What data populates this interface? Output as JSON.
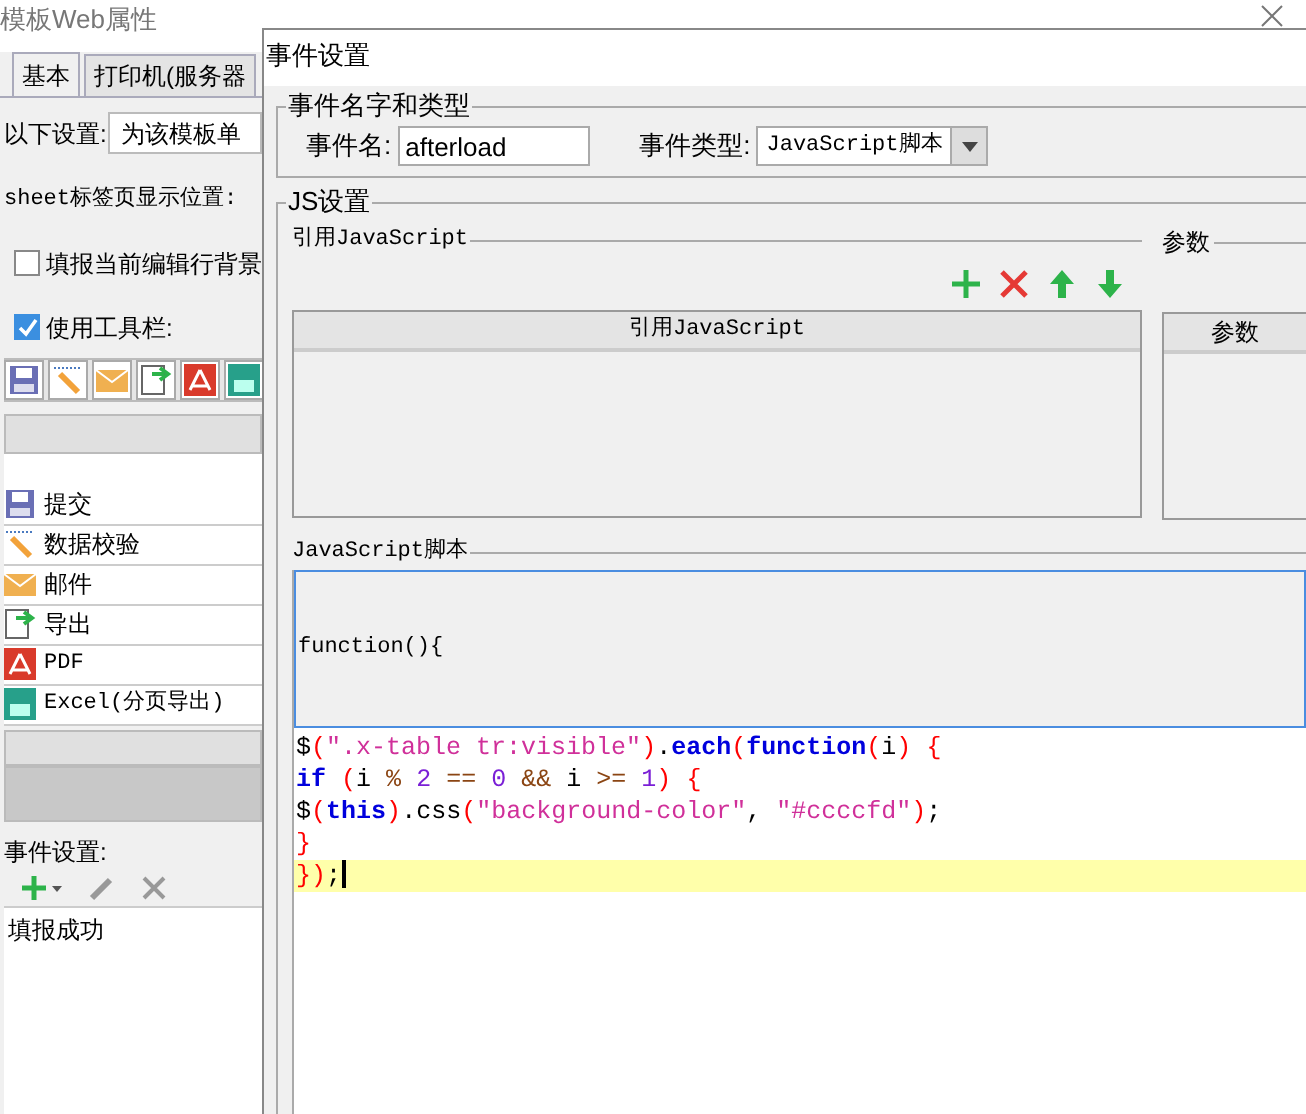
{
  "back_window": {
    "title": "模板Web属性",
    "tabs": [
      {
        "label": "基本",
        "selected": true
      },
      {
        "label": "打印机(服务器",
        "selected": false
      }
    ],
    "setting_label": "以下设置:",
    "setting_value": "为该模板单",
    "sheet_label": "sheet标签页显示位置:",
    "options": [
      {
        "label": "填报当前编辑行背景",
        "checked": false
      },
      {
        "label": "使用工具栏:",
        "checked": true
      }
    ],
    "toolbar_items": [
      {
        "label": "提交",
        "kind": "save"
      },
      {
        "label": "数据校验",
        "kind": "pencil"
      },
      {
        "label": "邮件",
        "kind": "mail"
      },
      {
        "label": "导出",
        "kind": "export"
      },
      {
        "label": "PDF",
        "kind": "pdf"
      },
      {
        "label": "Excel(分页导出)",
        "kind": "excel"
      }
    ],
    "events_label": "事件设置:",
    "events": [
      "填报成功"
    ]
  },
  "dialog": {
    "title": "事件设置",
    "name_group": {
      "legend": "事件名字和类型",
      "name_label": "事件名:",
      "name_value": "afterload",
      "type_label": "事件类型:",
      "type_value": "JavaScript脚本"
    },
    "js_group": {
      "legend": "JS设置",
      "ref_legend": "引用JavaScript",
      "param_legend": "参数",
      "ref_column": "引用JavaScript",
      "param_column": "参数",
      "script_legend": "JavaScript脚本",
      "header_text": "function(){",
      "code": [
        {
          "current": false,
          "tokens": [
            {
              "text": "$",
              "kind": "plain"
            },
            {
              "text": "(",
              "kind": "paren"
            },
            {
              "text": "\".x-table tr:visible\"",
              "kind": "string"
            },
            {
              "text": ")",
              "kind": "paren"
            },
            {
              "text": ".",
              "kind": "plain"
            },
            {
              "text": "each",
              "kind": "keyword"
            },
            {
              "text": "(",
              "kind": "paren"
            },
            {
              "text": "function",
              "kind": "keyword"
            },
            {
              "text": "(",
              "kind": "paren"
            },
            {
              "text": "i",
              "kind": "plain"
            },
            {
              "text": ")",
              "kind": "paren"
            },
            {
              "text": " {",
              "kind": "paren"
            }
          ]
        },
        {
          "current": false,
          "tokens": [
            {
              "text": "if",
              "kind": "keyword"
            },
            {
              "text": " (",
              "kind": "paren"
            },
            {
              "text": "i ",
              "kind": "plain"
            },
            {
              "text": "%",
              "kind": "operator"
            },
            {
              "text": " 2",
              "kind": "number"
            },
            {
              "text": " ==",
              "kind": "operator"
            },
            {
              "text": " 0",
              "kind": "number"
            },
            {
              "text": " &&",
              "kind": "operator"
            },
            {
              "text": " i ",
              "kind": "plain"
            },
            {
              "text": ">=",
              "kind": "operator"
            },
            {
              "text": " 1",
              "kind": "number"
            },
            {
              "text": ")",
              "kind": "paren"
            },
            {
              "text": " {",
              "kind": "paren"
            }
          ]
        },
        {
          "current": false,
          "tokens": [
            {
              "text": "$",
              "kind": "plain"
            },
            {
              "text": "(",
              "kind": "paren"
            },
            {
              "text": "this",
              "kind": "keyword"
            },
            {
              "text": ")",
              "kind": "paren"
            },
            {
              "text": ".css",
              "kind": "plain"
            },
            {
              "text": "(",
              "kind": "paren"
            },
            {
              "text": "\"background-color\"",
              "kind": "string"
            },
            {
              "text": ", ",
              "kind": "plain"
            },
            {
              "text": "\"#ccccfd\"",
              "kind": "string"
            },
            {
              "text": ")",
              "kind": "paren"
            },
            {
              "text": ";",
              "kind": "plain"
            }
          ]
        },
        {
          "current": false,
          "tokens": [
            {
              "text": "}",
              "kind": "paren"
            }
          ]
        },
        {
          "current": true,
          "tokens": [
            {
              "text": "})",
              "kind": "paren"
            },
            {
              "text": ";",
              "kind": "plain"
            }
          ]
        }
      ]
    }
  }
}
